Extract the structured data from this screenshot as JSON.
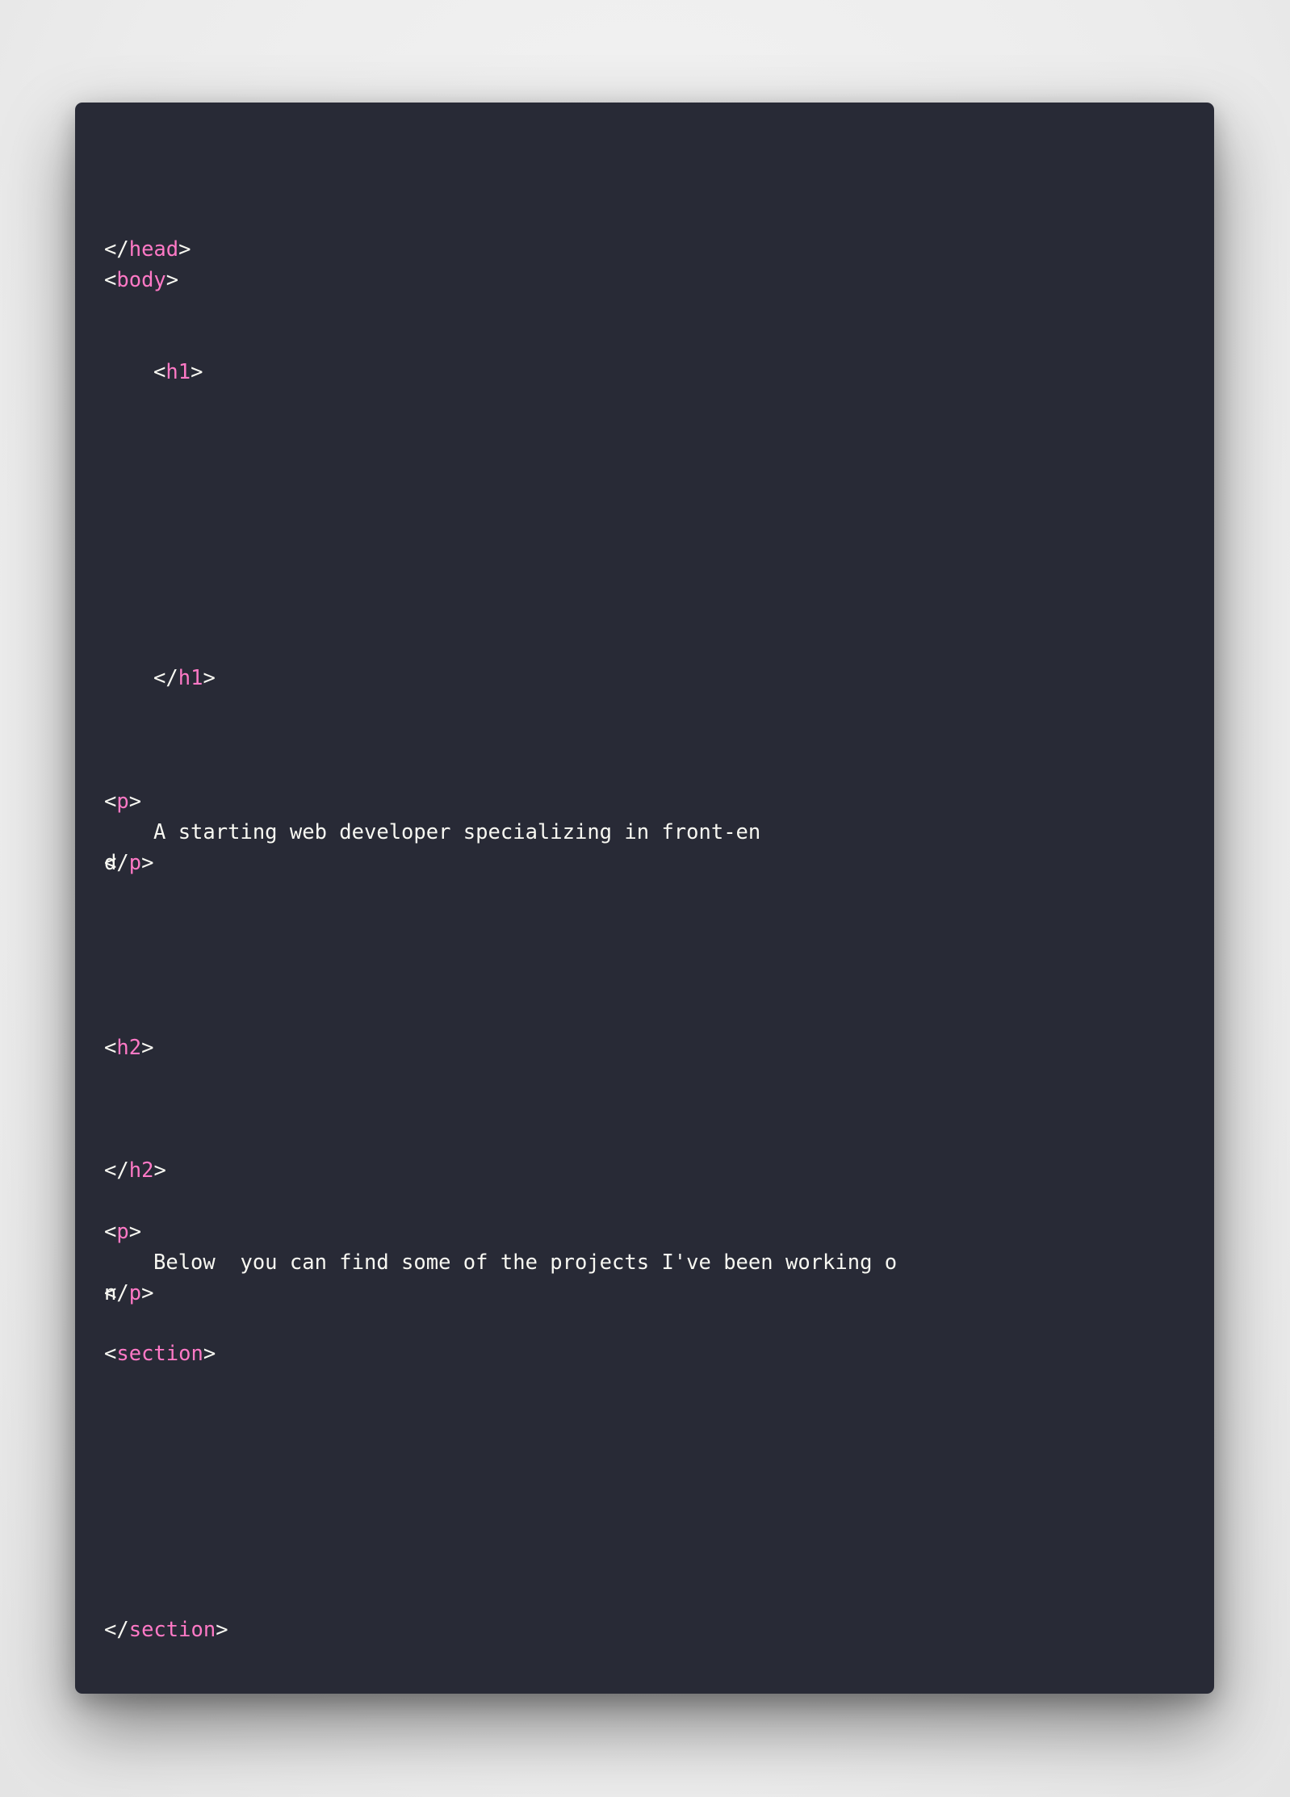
{
  "code_lines": [
    {
      "id": "head-close",
      "open": "</",
      "tag": "head",
      "close": ">"
    },
    {
      "id": "body-open",
      "open": "<",
      "tag": "body",
      "close": ">"
    },
    {
      "id": "h1-open",
      "open": "<",
      "tag": "h1",
      "close": ">"
    },
    {
      "id": "h1-close",
      "open": "</",
      "tag": "h1",
      "close": ">"
    },
    {
      "id": "p1-open",
      "open": "<",
      "tag": "p",
      "close": ">"
    },
    {
      "id": "p1-text",
      "text": "A starting web developer specializing in front-en"
    },
    {
      "id": "p1-wrap",
      "wrap": "d",
      "open": "</",
      "tag": "p",
      "close": ">"
    },
    {
      "id": "h2-open",
      "open": "<",
      "tag": "h2",
      "close": ">"
    },
    {
      "id": "h2-close",
      "open": "</",
      "tag": "h2",
      "close": ">"
    },
    {
      "id": "p2-open",
      "open": "<",
      "tag": "p",
      "close": ">"
    },
    {
      "id": "p2-text",
      "text": "Below  you can find some of the projects I've been working o"
    },
    {
      "id": "p2-wrap",
      "wrap": "n",
      "open": "</",
      "tag": "p",
      "close": ">"
    },
    {
      "id": "section-open",
      "open": "<",
      "tag": "section",
      "close": ">"
    },
    {
      "id": "section-close",
      "open": "</",
      "tag": "section",
      "close": ">"
    }
  ],
  "colors": {
    "background": "#282a36",
    "tag": "#ff79c6",
    "text": "#f8f8f2"
  }
}
